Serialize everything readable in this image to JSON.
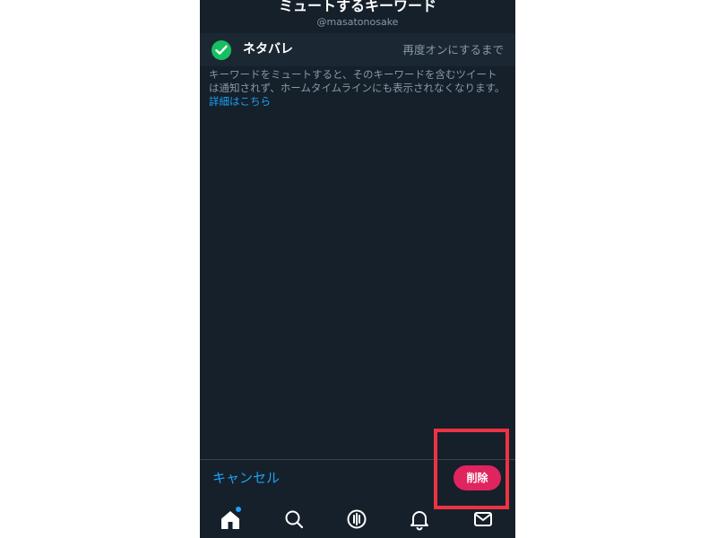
{
  "header": {
    "title": "ミュートするキーワード",
    "handle": "@masatonosake"
  },
  "keyword": {
    "label": "ネタバレ",
    "duration": "再度オンにするまで",
    "checked": true
  },
  "description": {
    "text": "キーワードをミュートすると、そのキーワードを含むツイートは通知されず、ホームタイムラインにも表示されなくなります。",
    "link": "詳細はこちら"
  },
  "actions": {
    "cancel_label": "キャンセル",
    "delete_label": "削除"
  },
  "tabs": [
    {
      "icon": "home-icon",
      "active": true,
      "has_badge": true
    },
    {
      "icon": "search-icon"
    },
    {
      "icon": "spaces-icon"
    },
    {
      "icon": "bell-icon"
    },
    {
      "icon": "mail-icon"
    }
  ],
  "colors": {
    "background": "#15202b",
    "row_background": "#1b2733",
    "accent": "#1da1f2",
    "delete": "#e0245e",
    "check": "#17bf63",
    "highlight": "#ed3343",
    "muted_text": "#8899a6"
  }
}
